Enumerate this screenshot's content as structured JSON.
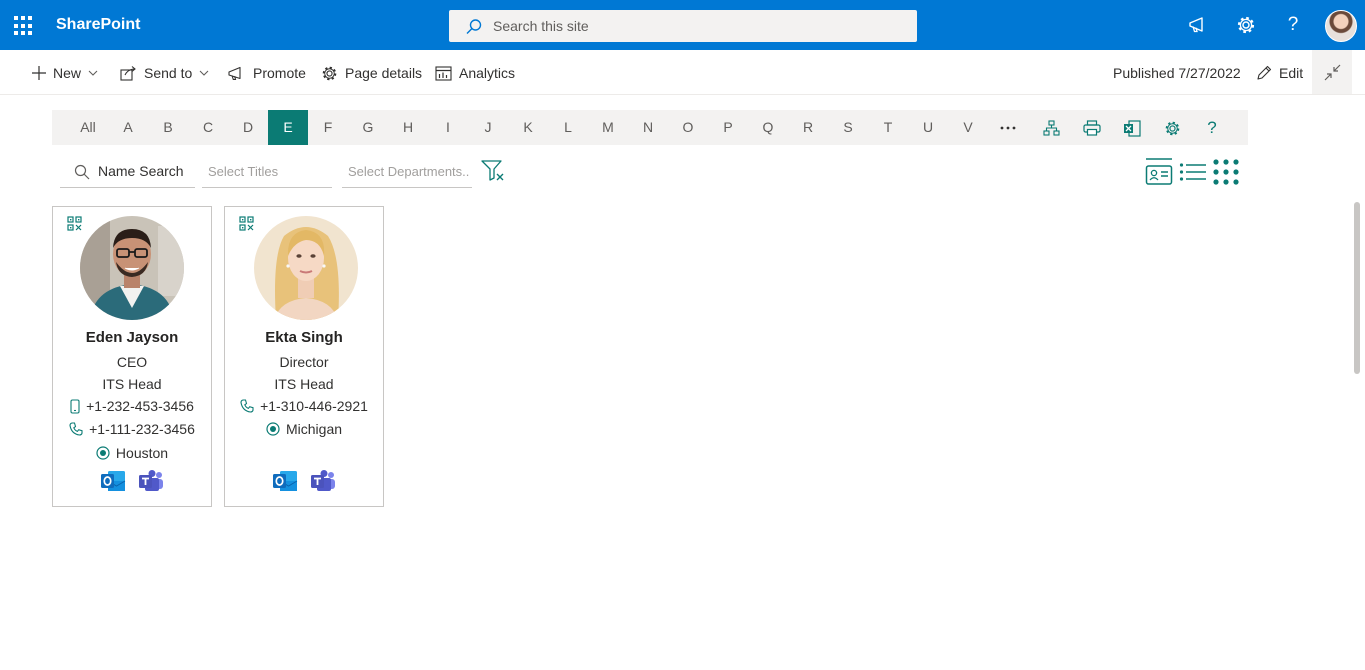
{
  "suite": {
    "app_name": "SharePoint",
    "search_placeholder": "Search this site",
    "icons": [
      "waffle-icon",
      "megaphone-icon",
      "gear-icon",
      "help-icon",
      "profile-avatar"
    ]
  },
  "command_bar": {
    "new_label": "New",
    "send_to_label": "Send to",
    "promote_label": "Promote",
    "page_details_label": "Page details",
    "analytics_label": "Analytics",
    "published_text": "Published 7/27/2022",
    "edit_label": "Edit"
  },
  "alphabet": {
    "letters": [
      "All",
      "A",
      "B",
      "C",
      "D",
      "E",
      "F",
      "G",
      "H",
      "I",
      "J",
      "K",
      "L",
      "M",
      "N",
      "O",
      "P",
      "Q",
      "R",
      "S",
      "T",
      "U",
      "V"
    ],
    "selected": "E",
    "tools": [
      "more-icon",
      "org-chart-icon",
      "print-icon",
      "excel-export-icon",
      "settings-icon",
      "help-icon"
    ]
  },
  "filters": {
    "name_placeholder": "Name Search",
    "titles_placeholder": "Select Titles",
    "departments_placeholder": "Select Departments..."
  },
  "colors": {
    "suite_bar": "#0078d4",
    "accent_teal": "#0b7b74"
  },
  "people": [
    {
      "name": "Eden Jayson",
      "title": "CEO",
      "department": "ITS Head",
      "mobile": "+1-232-453-3456",
      "phone": "+1-111-232-3456",
      "location": "Houston"
    },
    {
      "name": "Ekta Singh",
      "title": "Director",
      "department": "ITS Head",
      "phone": "+1-310-446-2921",
      "location": "Michigan"
    }
  ]
}
